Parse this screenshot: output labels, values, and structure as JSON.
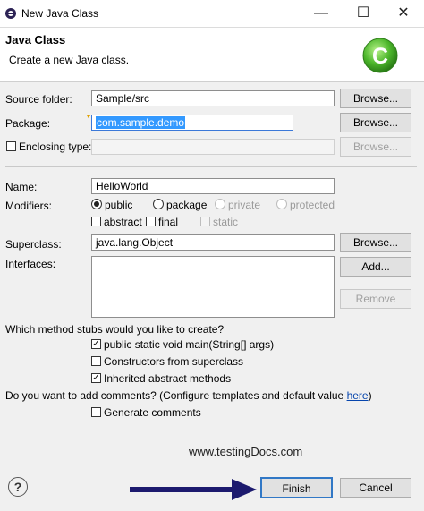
{
  "window": {
    "title": "New Java Class",
    "minimize": "—",
    "maximize": "☐",
    "close": "✕"
  },
  "header": {
    "title": "Java Class",
    "subtitle": "Create a new Java class."
  },
  "source_folder": {
    "label": "Source folder:",
    "value": "Sample/src",
    "browse": "Browse..."
  },
  "package": {
    "label": "Package:",
    "value": "com.sample.demo",
    "browse": "Browse..."
  },
  "enclosing": {
    "label": "Enclosing type:",
    "value": "",
    "browse": "Browse..."
  },
  "name": {
    "label": "Name:",
    "value": "HelloWorld"
  },
  "modifiers": {
    "label": "Modifiers:",
    "public": "public",
    "package": "package",
    "private": "private",
    "protected": "protected",
    "abstract": "abstract",
    "final": "final",
    "static": "static",
    "selected": "public"
  },
  "superclass": {
    "label": "Superclass:",
    "value": "java.lang.Object",
    "browse": "Browse..."
  },
  "interfaces": {
    "label": "Interfaces:",
    "add": "Add...",
    "remove": "Remove"
  },
  "stubs": {
    "question": "Which method stubs would you like to create?",
    "main": "public static void main(String[] args)",
    "constructors": "Constructors from superclass",
    "inherited": "Inherited abstract methods"
  },
  "comments": {
    "question": "Do you want to add comments? (Configure templates and default value ",
    "link": "here",
    "question_end": ")",
    "generate": "Generate comments"
  },
  "watermark": "www.testingDocs.com",
  "footer": {
    "help": "?",
    "finish": "Finish",
    "cancel": "Cancel"
  }
}
